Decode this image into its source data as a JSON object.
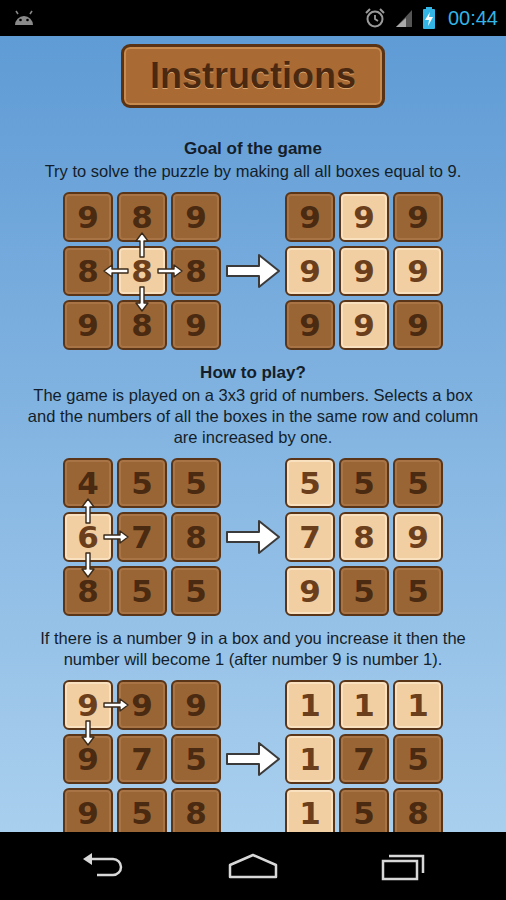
{
  "status_bar": {
    "time": "00:44"
  },
  "title": "Instructions",
  "blocks": [
    {
      "kind": "heading",
      "text": "Goal of the game"
    },
    {
      "kind": "text",
      "text": "Try to solve the puzzle by making all all boxes equal to 9."
    },
    {
      "kind": "example",
      "before": [
        [
          {
            "n": "9",
            "lit": false
          },
          {
            "n": "8",
            "lit": false
          },
          {
            "n": "9",
            "lit": false
          }
        ],
        [
          {
            "n": "8",
            "lit": false
          },
          {
            "n": "8",
            "lit": true,
            "arrows": [
              "up",
              "down",
              "left",
              "right"
            ]
          },
          {
            "n": "8",
            "lit": false
          }
        ],
        [
          {
            "n": "9",
            "lit": false
          },
          {
            "n": "8",
            "lit": false
          },
          {
            "n": "9",
            "lit": false
          }
        ]
      ],
      "after": [
        [
          {
            "n": "9",
            "lit": false
          },
          {
            "n": "9",
            "lit": true
          },
          {
            "n": "9",
            "lit": false
          }
        ],
        [
          {
            "n": "9",
            "lit": true
          },
          {
            "n": "9",
            "lit": true
          },
          {
            "n": "9",
            "lit": true
          }
        ],
        [
          {
            "n": "9",
            "lit": false
          },
          {
            "n": "9",
            "lit": true
          },
          {
            "n": "9",
            "lit": false
          }
        ]
      ]
    },
    {
      "kind": "heading",
      "text": "How to play?"
    },
    {
      "kind": "text",
      "text": "The game is played on a 3x3 grid of numbers. Selects a box and the numbers of all the boxes in the same row and column are increased by one."
    },
    {
      "kind": "example",
      "before": [
        [
          {
            "n": "4",
            "lit": false
          },
          {
            "n": "5",
            "lit": false
          },
          {
            "n": "5",
            "lit": false
          }
        ],
        [
          {
            "n": "6",
            "lit": true,
            "arrows": [
              "up",
              "down",
              "right"
            ]
          },
          {
            "n": "7",
            "lit": false
          },
          {
            "n": "8",
            "lit": false
          }
        ],
        [
          {
            "n": "8",
            "lit": false
          },
          {
            "n": "5",
            "lit": false
          },
          {
            "n": "5",
            "lit": false
          }
        ]
      ],
      "after": [
        [
          {
            "n": "5",
            "lit": true
          },
          {
            "n": "5",
            "lit": false
          },
          {
            "n": "5",
            "lit": false
          }
        ],
        [
          {
            "n": "7",
            "lit": true
          },
          {
            "n": "8",
            "lit": true
          },
          {
            "n": "9",
            "lit": true
          }
        ],
        [
          {
            "n": "9",
            "lit": true
          },
          {
            "n": "5",
            "lit": false
          },
          {
            "n": "5",
            "lit": false
          }
        ]
      ]
    },
    {
      "kind": "text",
      "text": "If there is a number 9 in a box and you increase it then the number will become 1 (after number 9 is number 1)."
    },
    {
      "kind": "example",
      "before": [
        [
          {
            "n": "9",
            "lit": true,
            "arrows": [
              "down",
              "right"
            ]
          },
          {
            "n": "9",
            "lit": false
          },
          {
            "n": "9",
            "lit": false
          }
        ],
        [
          {
            "n": "9",
            "lit": false
          },
          {
            "n": "7",
            "lit": false
          },
          {
            "n": "5",
            "lit": false
          }
        ],
        [
          {
            "n": "9",
            "lit": false
          },
          {
            "n": "5",
            "lit": false
          },
          {
            "n": "8",
            "lit": false
          }
        ]
      ],
      "after": [
        [
          {
            "n": "1",
            "lit": true
          },
          {
            "n": "1",
            "lit": true
          },
          {
            "n": "1",
            "lit": true
          }
        ],
        [
          {
            "n": "1",
            "lit": true
          },
          {
            "n": "7",
            "lit": false
          },
          {
            "n": "5",
            "lit": false
          }
        ],
        [
          {
            "n": "1",
            "lit": true
          },
          {
            "n": "5",
            "lit": false
          },
          {
            "n": "8",
            "lit": false
          }
        ]
      ]
    }
  ]
}
